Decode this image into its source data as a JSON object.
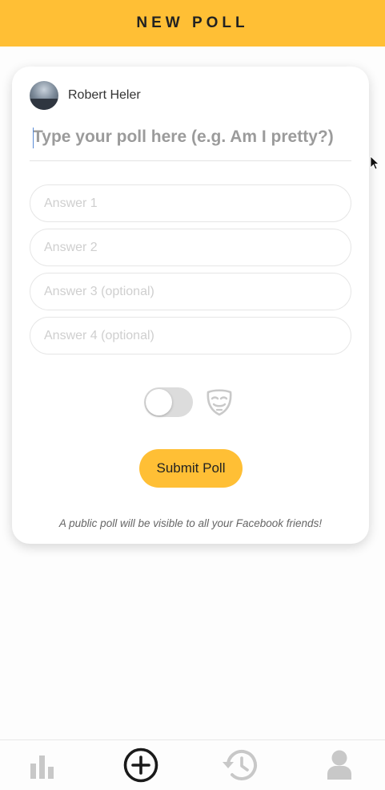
{
  "header": {
    "title": "NEW POLL"
  },
  "composer": {
    "user_name": "Robert Heler",
    "question_placeholder": "Type your poll here (e.g. Am I pretty?)",
    "answers": [
      {
        "placeholder": "Answer 1"
      },
      {
        "placeholder": "Answer 2"
      },
      {
        "placeholder": "Answer 3 (optional)"
      },
      {
        "placeholder": "Answer 4 (optional)"
      }
    ],
    "anonymous_toggle": {
      "on": false,
      "icon": "anonymous-mask-icon"
    },
    "submit_label": "Submit Poll",
    "footnote": "A public poll will be visible to all your Facebook friends!"
  },
  "tabbar": {
    "tabs": [
      {
        "icon": "bar-chart-icon",
        "active": false
      },
      {
        "icon": "plus-circle-icon",
        "active": true
      },
      {
        "icon": "history-icon",
        "active": false
      },
      {
        "icon": "person-icon",
        "active": false
      }
    ]
  },
  "colors": {
    "accent": "#ffbf35",
    "inactive_icon": "#c8c8c8",
    "active_icon": "#1a1a1a"
  }
}
